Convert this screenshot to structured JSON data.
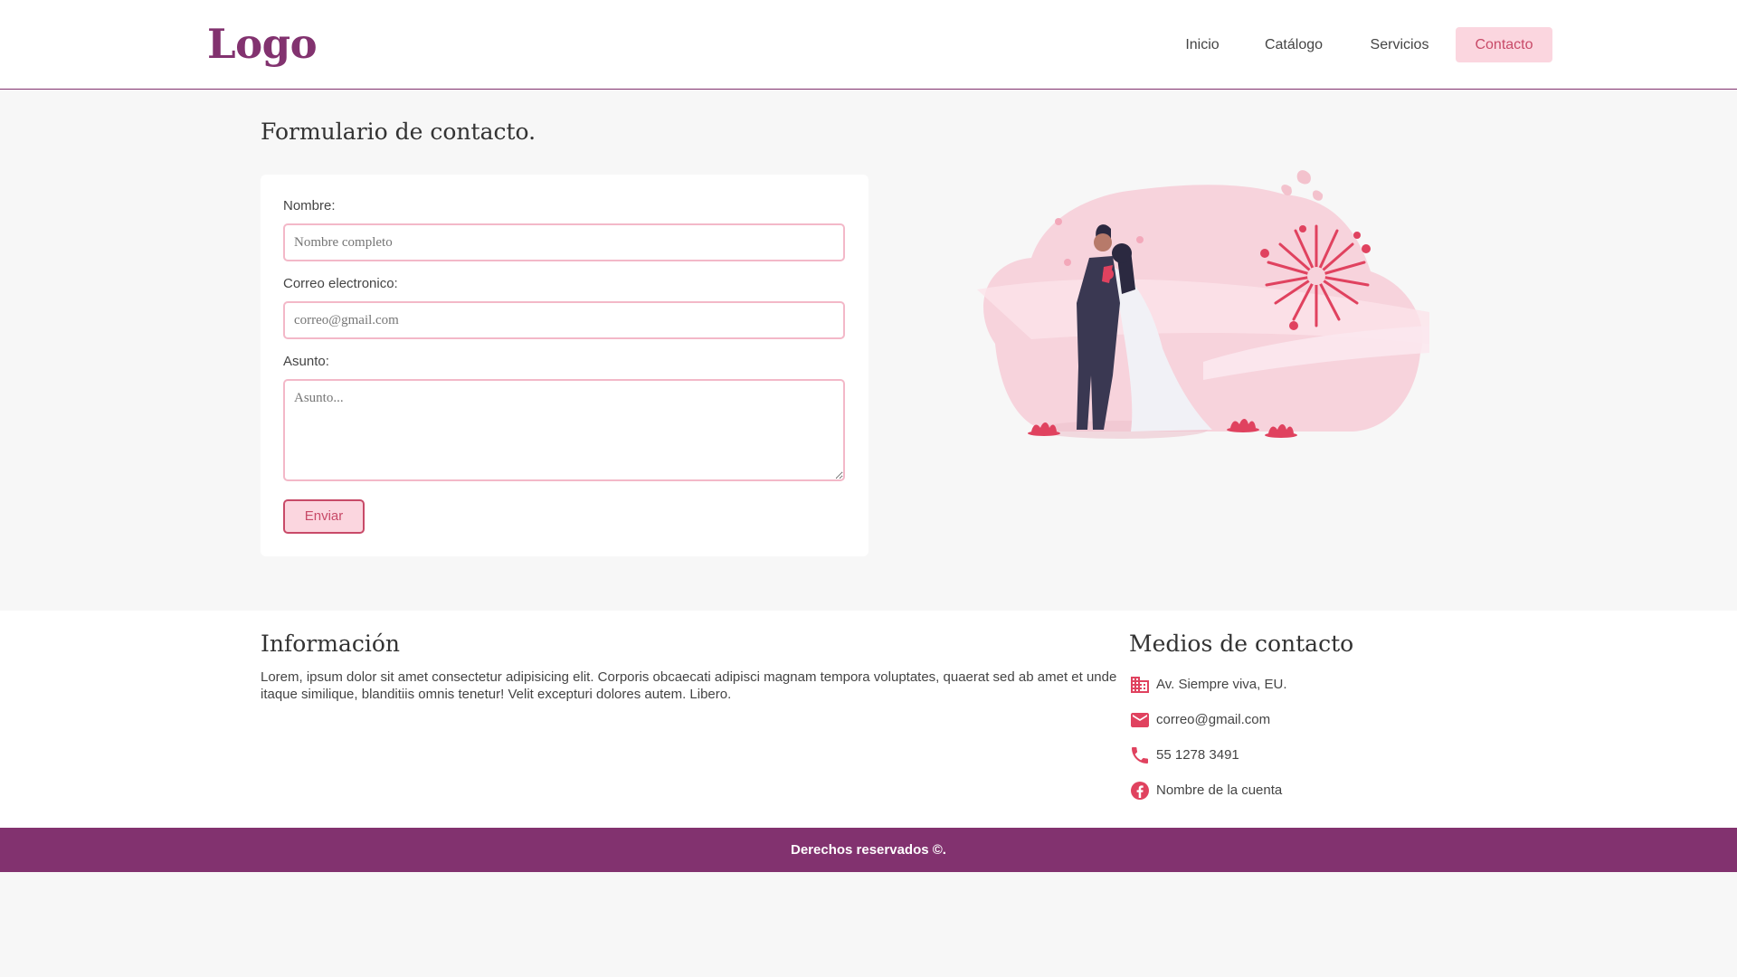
{
  "header": {
    "logo": "Logo",
    "nav": [
      "Inicio",
      "Catálogo",
      "Servicios",
      "Contacto"
    ],
    "active_nav": "Contacto"
  },
  "main": {
    "title": "Formulario de contacto.",
    "form": {
      "name_label": "Nombre:",
      "name_placeholder": "Nombre completo",
      "email_label": "Correo electronico:",
      "email_placeholder": "correo@gmail.com",
      "subject_label": "Asunto:",
      "subject_placeholder": "Asunto...",
      "submit_label": "Enviar"
    },
    "illustration_icon": "wedding-couple-illustration"
  },
  "footer": {
    "info_title": "Información",
    "info_text": "Lorem, ipsum dolor sit amet consectetur adipisicing elit. Corporis obcaecati adipisci magnam tempora voluptates, quaerat sed ab amet et unde itaque similique, blanditiis omnis tenetur! Velit excepturi dolores autem. Libero.",
    "contact_title": "Medios de contacto",
    "contacts": [
      {
        "icon": "building-icon",
        "text": "Av. Siempre viva, EU."
      },
      {
        "icon": "mail-icon",
        "text": "correo@gmail.com"
      },
      {
        "icon": "phone-icon",
        "text": "55 1278 3491"
      },
      {
        "icon": "facebook-icon",
        "text": "Nombre de la cuenta"
      }
    ],
    "copyright": "Derechos reservados ©."
  },
  "colors": {
    "brand": "#82326f",
    "accent": "#c84a68",
    "accent_light": "#fbd6df",
    "icon": "#e0425f",
    "background": "#f7f7f7"
  }
}
